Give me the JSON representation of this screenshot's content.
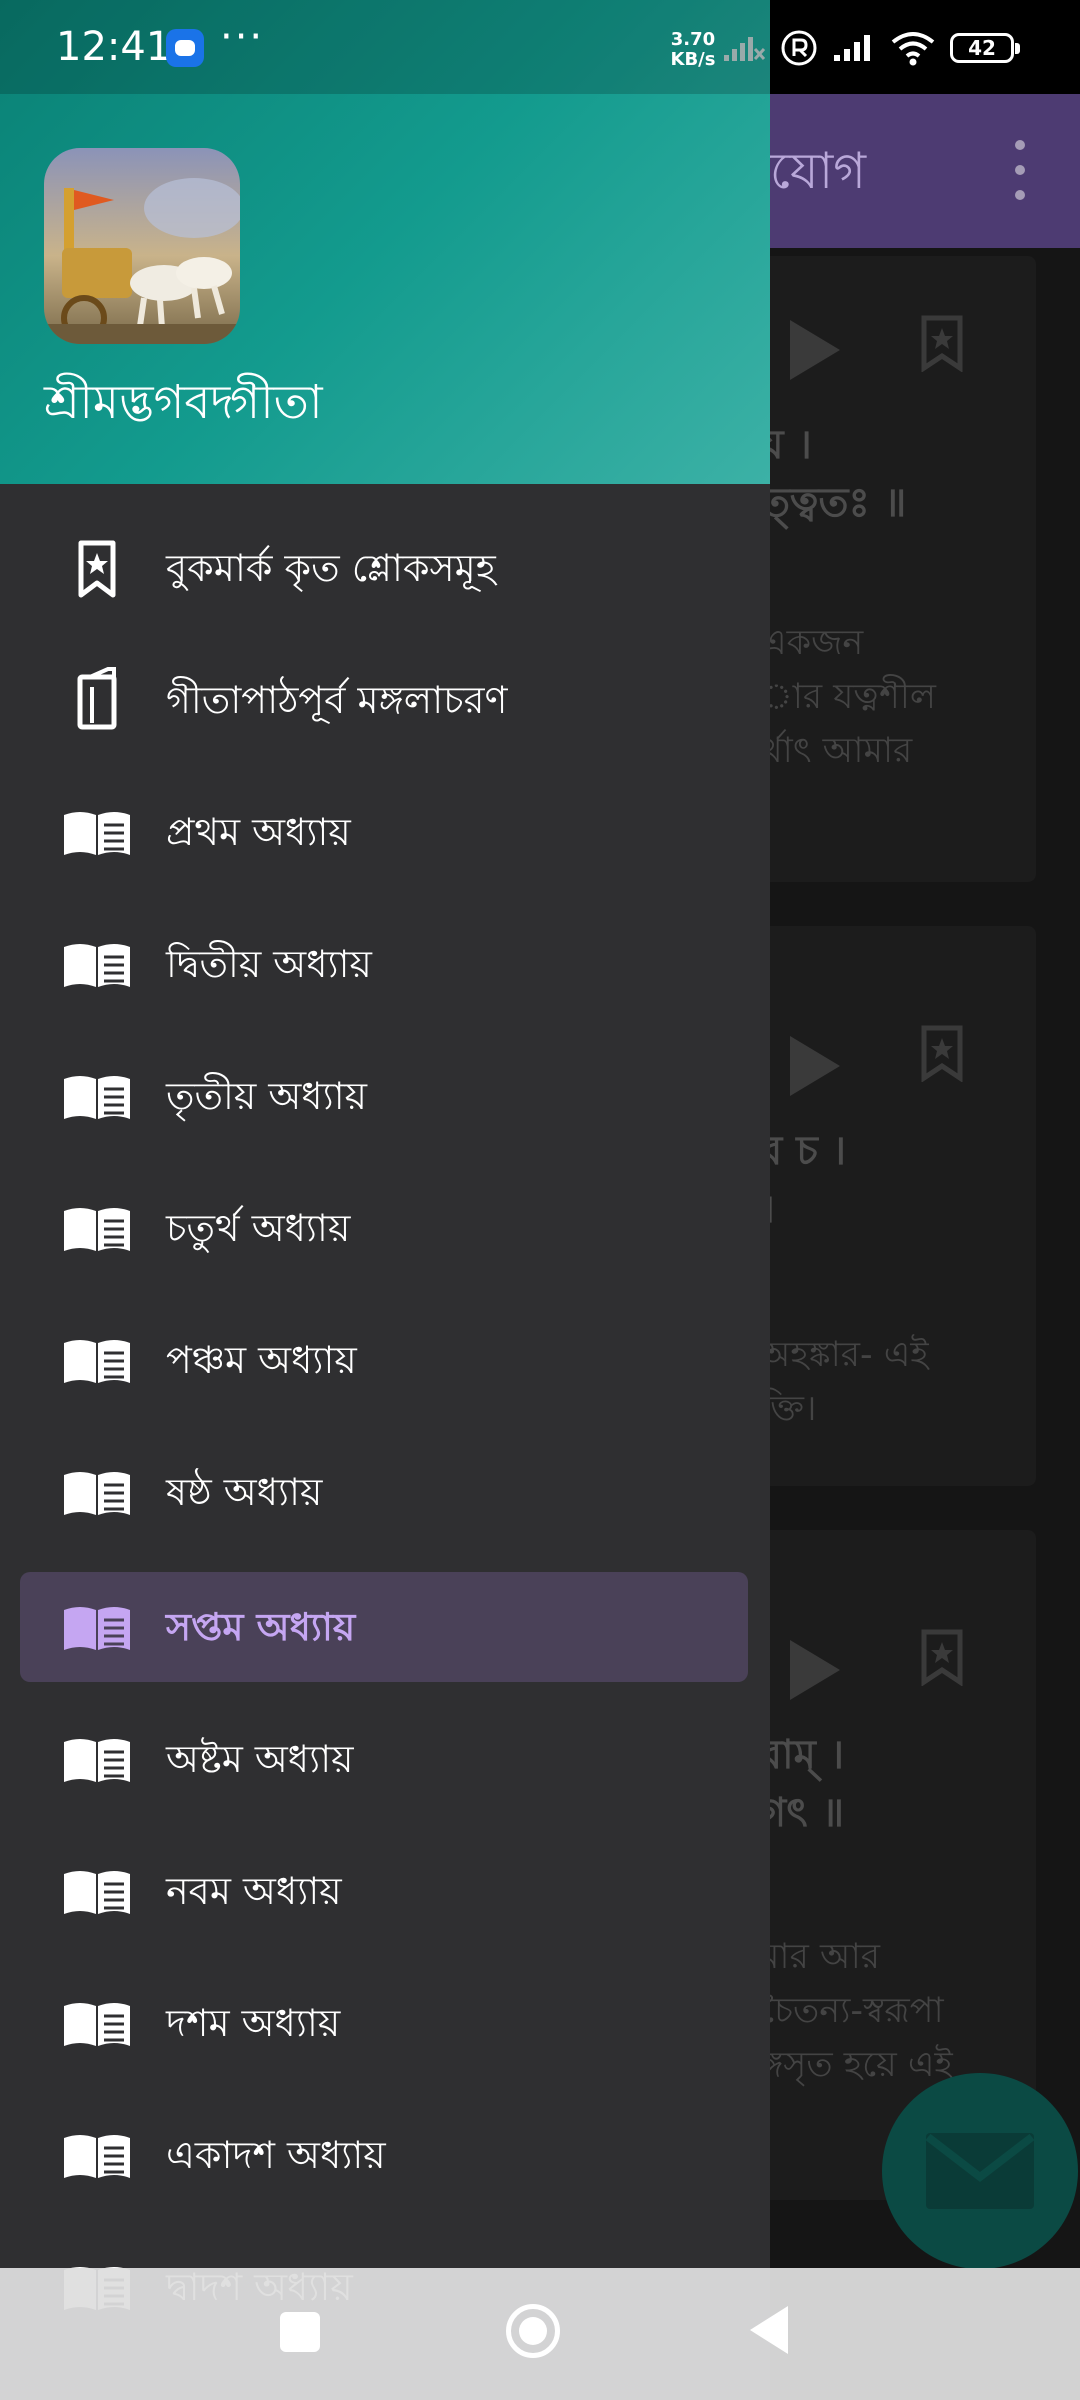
{
  "status_bar": {
    "time": "12:41",
    "more": "···",
    "net_speed_value": "3.70",
    "net_speed_unit": "KB/s",
    "battery": "42"
  },
  "background": {
    "appbar_title": "নযোগ",
    "cards": [
      {
        "verse_lines": [
          "য় ।",
          "ত্ত্বতঃ ॥"
        ],
        "meaning_lines": [
          "একজন",
          "ার যত্নশীল",
          "র্থাৎ আমার"
        ]
      },
      {
        "verse_lines": [
          "ব চ ।",
          "।"
        ],
        "meaning_lines": [
          "অহঙ্কার- এই",
          "ক্তি।"
        ]
      },
      {
        "verse_lines": [
          "রাম্ ।",
          "গৎ ॥"
        ],
        "meaning_lines": [
          "মার আর",
          "চৈতন্য-স্বরূপা",
          "ঙ্গসৃত হয়ে এই"
        ]
      }
    ],
    "colors": {
      "appbar": "#4d3b72",
      "fab": "#0b4a44"
    }
  },
  "drawer": {
    "app_name": "শ্রীমদ্ভগবদ্গীতা",
    "colors": {
      "header_start": "#0a8175",
      "header_end": "#3cb1a6",
      "selected_text": "#c5a6f2",
      "selected_bg": "#4a4158"
    },
    "items": [
      {
        "label": "বুকমার্ক কৃত শ্লোকসমূহ",
        "icon": "bookmark-star-icon"
      },
      {
        "label": "গীতাপাঠপূর্ব মঙ্গলাচরণ",
        "icon": "book-pages-icon"
      },
      {
        "label": "প্রথম অধ্যায়",
        "icon": "open-book-icon"
      },
      {
        "label": "দ্বিতীয় অধ্যায়",
        "icon": "open-book-icon"
      },
      {
        "label": "তৃতীয় অধ্যায়",
        "icon": "open-book-icon"
      },
      {
        "label": "চতুর্থ অধ্যায়",
        "icon": "open-book-icon"
      },
      {
        "label": "পঞ্চম অধ্যায়",
        "icon": "open-book-icon"
      },
      {
        "label": "ষষ্ঠ অধ্যায়",
        "icon": "open-book-icon"
      },
      {
        "label": "সপ্তম অধ্যায়",
        "icon": "open-book-icon",
        "selected": true
      },
      {
        "label": "অষ্টম অধ্যায়",
        "icon": "open-book-icon"
      },
      {
        "label": "নবম অধ্যায়",
        "icon": "open-book-icon"
      },
      {
        "label": "দশম অধ্যায়",
        "icon": "open-book-icon"
      },
      {
        "label": "একাদশ অধ্যায়",
        "icon": "open-book-icon"
      },
      {
        "label": "দ্বাদশ অধ্যায়",
        "icon": "open-book-icon"
      }
    ]
  }
}
